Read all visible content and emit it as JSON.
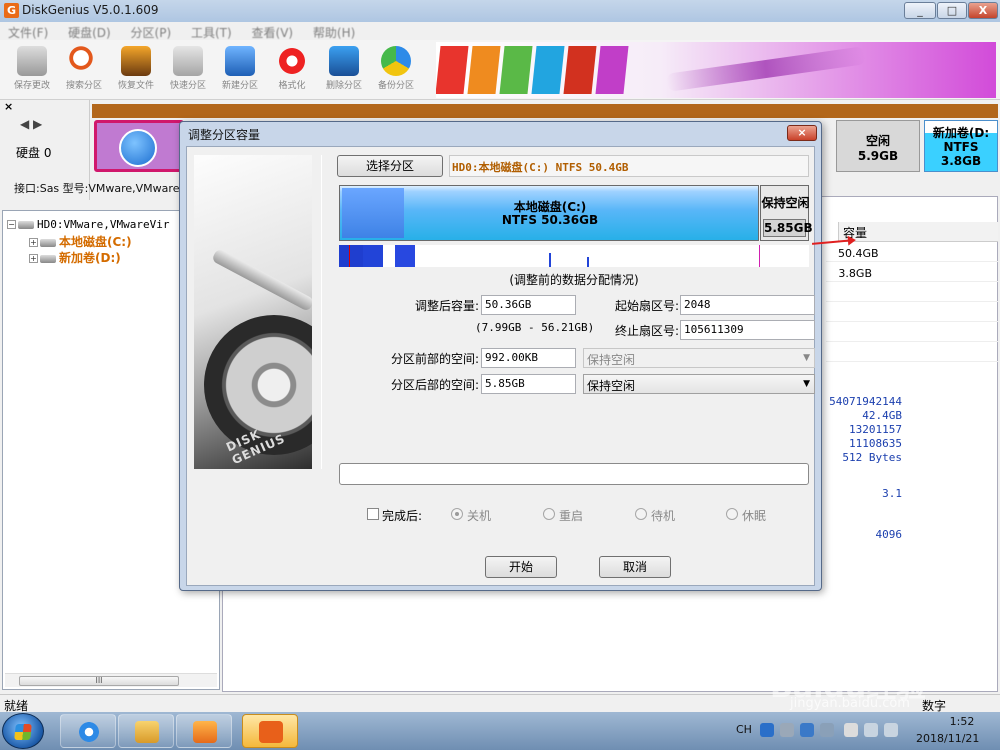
{
  "app": {
    "title": "DiskGenius V5.0.1.609"
  },
  "window_controls": {
    "minimize": "_",
    "maximize": "□",
    "close": "X"
  },
  "menu": [
    "文件(F)",
    "硬盘(D)",
    "分区(P)",
    "工具(T)",
    "查看(V)",
    "帮助(H)"
  ],
  "toolbar": [
    "保存更改",
    "搜索分区",
    "恢复文件",
    "快速分区",
    "新建分区",
    "格式化",
    "删除分区",
    "备份分区"
  ],
  "diskmap": {
    "pin": "×",
    "nav": "◀ ▶",
    "disk_label": "硬盘 0",
    "free": {
      "name": "空闲",
      "size": "5.9GB"
    },
    "d_volume": {
      "name": "新加卷(D:",
      "fs": "NTFS",
      "size": "3.8GB"
    }
  },
  "disk_info_line": "接口:Sas  型号:VMware,VMwareVirtu",
  "tree": {
    "disk": "HD0:VMware,VMwareVir",
    "items": [
      "本地磁盘(C:)",
      "新加卷(D:)"
    ],
    "scroll_grip": "III"
  },
  "right_panel": {
    "col_capacity": "容量",
    "rows": [
      "50.4GB",
      "3.8GB"
    ],
    "details": [
      "54071942144",
      "42.4GB",
      "13201157",
      "11108635",
      "512 Bytes"
    ],
    "version": "3.1",
    "cluster": "4096"
  },
  "status": {
    "left": "就绪",
    "right": "数字"
  },
  "dialog": {
    "title": "调整分区容量",
    "close": "×",
    "art_text": "DISK GENIUS",
    "select_partition_btn": "选择分区",
    "partition_info": "HD0:本地磁盘(C:) NTFS 50.4GB",
    "bar": {
      "c_name": "本地磁盘(C:)",
      "c_fs_size": "NTFS 50.36GB",
      "free_label": "保持空闲",
      "free_size": "5.85GB",
      "used_fraction": 0.15
    },
    "distribution_caption": "(调整前的数据分配情况)",
    "fields": {
      "new_size_label": "调整后容量:",
      "new_size": "50.36GB",
      "range": "(7.99GB - 56.21GB)",
      "start_sector_label": "起始扇区号:",
      "start_sector": "2048",
      "end_sector_label": "终止扇区号:",
      "end_sector": "105611309",
      "before_label": "分区前部的空间:",
      "before_value": "992.00KB",
      "before_option": "保持空闲",
      "after_label": "分区后部的空间:",
      "after_value": "5.85GB",
      "after_option": "保持空闲"
    },
    "after_done": {
      "label": "完成后:",
      "options": [
        "关机",
        "重启",
        "待机",
        "休眠"
      ]
    },
    "start_btn": "开始",
    "cancel_btn": "取消"
  },
  "taskbar": {
    "lang": "CH",
    "time": "1:52",
    "date": "2018/11/21"
  },
  "watermark": {
    "brand": "Baidu经验",
    "url": "jingyan.baidu.com"
  }
}
